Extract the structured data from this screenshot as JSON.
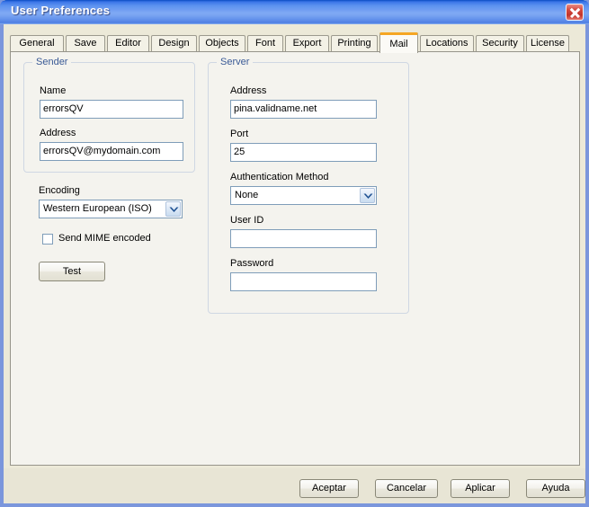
{
  "window": {
    "title": "User Preferences",
    "close_icon": "close-icon",
    "accent_title_color": "#3c76e8",
    "tab_selected_marker_color": "#f5a623"
  },
  "tabs": [
    {
      "label": "General",
      "selected": false
    },
    {
      "label": "Save",
      "selected": false
    },
    {
      "label": "Editor",
      "selected": false
    },
    {
      "label": "Design",
      "selected": false
    },
    {
      "label": "Objects",
      "selected": false
    },
    {
      "label": "Font",
      "selected": false
    },
    {
      "label": "Export",
      "selected": false
    },
    {
      "label": "Printing",
      "selected": false
    },
    {
      "label": "Mail",
      "selected": true
    },
    {
      "label": "Locations",
      "selected": false
    },
    {
      "label": "Security",
      "selected": false
    },
    {
      "label": "License",
      "selected": false
    }
  ],
  "sender": {
    "legend": "Sender",
    "name_label": "Name",
    "name_value": "errorsQV",
    "address_label": "Address",
    "address_value": "errorsQV@mydomain.com"
  },
  "server": {
    "legend": "Server",
    "address_label": "Address",
    "address_value": "pina.validname.net",
    "port_label": "Port",
    "port_value": "25",
    "auth_label": "Authentication Method",
    "auth_value": "None",
    "userid_label": "User ID",
    "userid_value": "",
    "password_label": "Password",
    "password_value": ""
  },
  "encoding": {
    "label": "Encoding",
    "value": "Western European (ISO)",
    "dropdown_icon": "chevron-down-icon"
  },
  "mime": {
    "label": "Send MIME encoded",
    "checked": false
  },
  "test": {
    "label": "Test"
  },
  "footer_buttons": [
    {
      "label": "Aceptar"
    },
    {
      "label": "Cancelar"
    },
    {
      "label": "Aplicar"
    },
    {
      "label": "Ayuda"
    }
  ]
}
